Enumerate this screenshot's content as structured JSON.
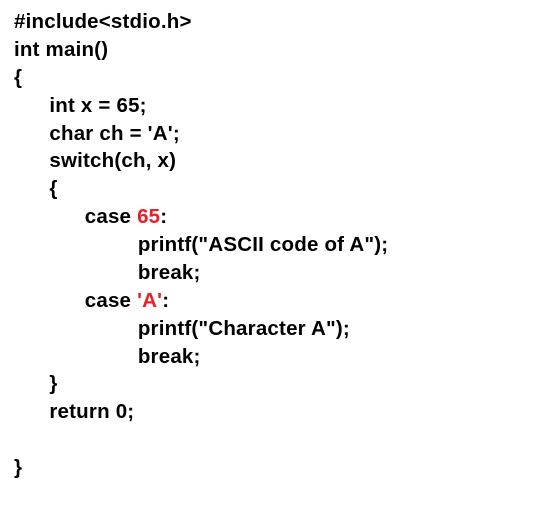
{
  "code": {
    "line1": "#include<stdio.h>",
    "line2": "int main()",
    "line3": "{",
    "line4_indent": "      ",
    "line4": "int x = 65;",
    "line5_indent": "      ",
    "line5": "char ch = 'A';",
    "line6_indent": "      ",
    "line6": "switch(ch, x)",
    "line7_indent": "      ",
    "line7": "{",
    "line8_indent": "            ",
    "line8a": "case ",
    "line8b": "65",
    "line8c": ":",
    "line9_indent": "                     ",
    "line9": "printf(\"ASCII code of A\");",
    "line10_indent": "                     ",
    "line10": "break;",
    "line11_indent": "            ",
    "line11a": "case ",
    "line11b": "'A'",
    "line11c": ":",
    "line12_indent": "                     ",
    "line12": "printf(\"Character A\");",
    "line13_indent": "                     ",
    "line13": "break;",
    "line14_indent": "      ",
    "line14": "}",
    "line15_indent": "      ",
    "line15": "return 0;",
    "line16": "",
    "line17": "}"
  }
}
